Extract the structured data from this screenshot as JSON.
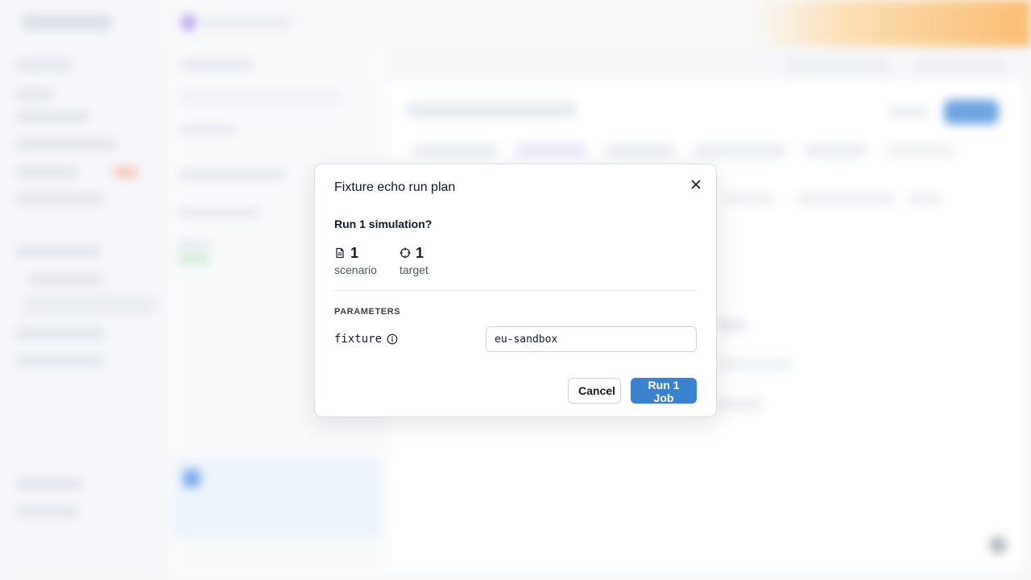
{
  "dialog": {
    "title": "Fixture echo run plan",
    "question": "Run 1 simulation?",
    "stats": [
      {
        "icon": "document-icon",
        "count": "1",
        "label": "scenario"
      },
      {
        "icon": "target-icon",
        "count": "1",
        "label": "target"
      }
    ],
    "parameters_heading": "PARAMETERS",
    "parameters": [
      {
        "name": "fixture",
        "value": "eu-sandbox"
      }
    ],
    "cancel_label": "Cancel",
    "run_label": "Run 1 Job"
  },
  "colors": {
    "primary": "#3a82d0",
    "text": "#111827",
    "muted": "#4b5563",
    "border": "#d1d5db"
  }
}
